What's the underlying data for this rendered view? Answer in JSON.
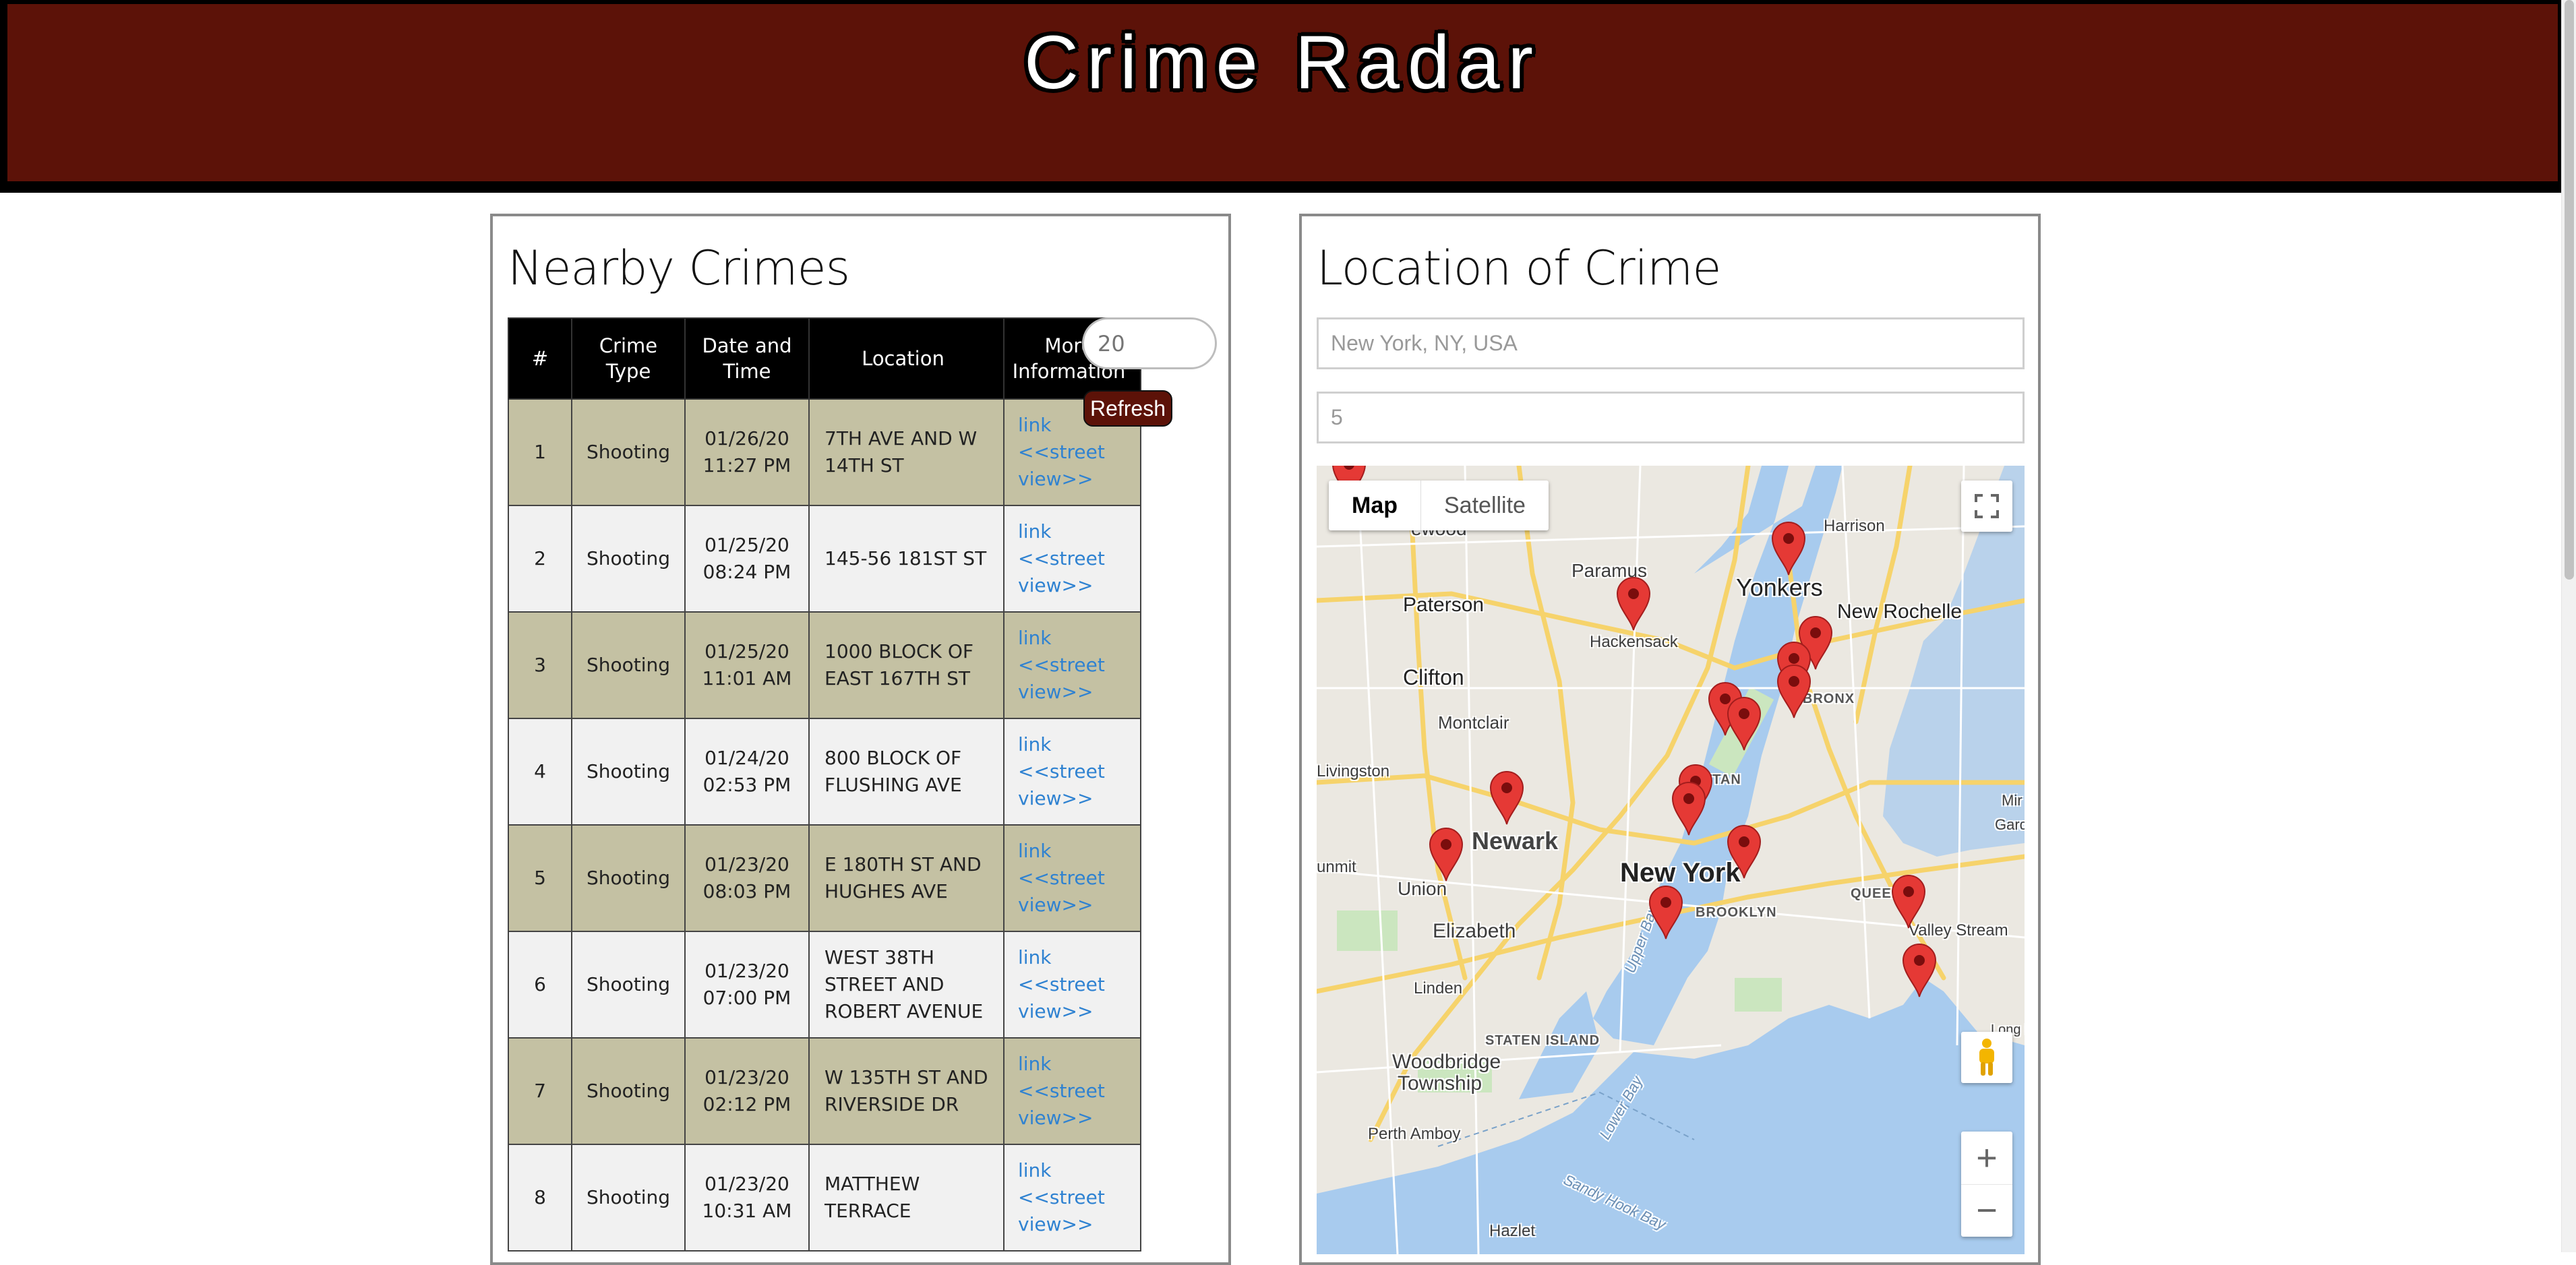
{
  "header": {
    "title": "Crime Radar"
  },
  "left_panel": {
    "title": "Nearby Crimes",
    "count_input": {
      "placeholder": "20"
    },
    "refresh_label": "Refresh",
    "columns": [
      "#",
      "Crime Type",
      "Date and Time",
      "Location",
      "More Information"
    ],
    "rows": [
      {
        "num": "1",
        "type": "Shooting",
        "date": "01/26/20",
        "time": "11:27 PM",
        "loc1": "7TH AVE AND W",
        "loc2": "14TH ST",
        "loc3": "",
        "link": "link",
        "street1": "<<street",
        "street2": "view>>"
      },
      {
        "num": "2",
        "type": "Shooting",
        "date": "01/25/20",
        "time": "08:24 PM",
        "loc1": "145-56 181ST ST",
        "loc2": "",
        "loc3": "",
        "link": "link",
        "street1": "<<street",
        "street2": "view>>"
      },
      {
        "num": "3",
        "type": "Shooting",
        "date": "01/25/20",
        "time": "11:01 AM",
        "loc1": "1000 BLOCK OF",
        "loc2": "EAST 167TH ST",
        "loc3": "",
        "link": "link",
        "street1": "<<street",
        "street2": "view>>"
      },
      {
        "num": "4",
        "type": "Shooting",
        "date": "01/24/20",
        "time": "02:53 PM",
        "loc1": "800 BLOCK OF",
        "loc2": "FLUSHING AVE",
        "loc3": "",
        "link": "link",
        "street1": "<<street",
        "street2": "view>>"
      },
      {
        "num": "5",
        "type": "Shooting",
        "date": "01/23/20",
        "time": "08:03 PM",
        "loc1": "E 180TH ST AND",
        "loc2": "HUGHES AVE",
        "loc3": "",
        "link": "link",
        "street1": "<<street",
        "street2": "view>>"
      },
      {
        "num": "6",
        "type": "Shooting",
        "date": "01/23/20",
        "time": "07:00 PM",
        "loc1": "WEST 38TH",
        "loc2": "STREET AND",
        "loc3": "ROBERT AVENUE",
        "link": "link",
        "street1": "<<street",
        "street2": "view>>"
      },
      {
        "num": "7",
        "type": "Shooting",
        "date": "01/23/20",
        "time": "02:12 PM",
        "loc1": "W 135TH ST AND",
        "loc2": "RIVERSIDE DR",
        "loc3": "",
        "link": "link",
        "street1": "<<street",
        "street2": "view>>"
      },
      {
        "num": "8",
        "type": "Shooting",
        "date": "01/23/20",
        "time": "10:31 AM",
        "loc1": "MATTHEW",
        "loc2": "TERRACE",
        "loc3": "",
        "link": "link",
        "street1": "<<street",
        "street2": "view>>"
      }
    ]
  },
  "right_panel": {
    "title": "Location of Crime",
    "location_input": {
      "placeholder": "New York, NY, USA"
    },
    "radius_input": {
      "placeholder": "5"
    },
    "map": {
      "map_type_buttons": [
        "Map",
        "Satellite"
      ],
      "zoom_in": "+",
      "zoom_out": "−",
      "labels": {
        "yonkers": "Yonkers",
        "new_rochelle": "New Rochelle",
        "paterson": "Paterson",
        "paramus": "Paramus",
        "hackensack": "Hackensack",
        "clifton": "Clifton",
        "montclair": "Montclair",
        "the_bronx": "E BRONX",
        "livingston": "Livingston",
        "newark": "Newark",
        "union": "Union",
        "new_york": "New York",
        "manhattan": "ATTAN",
        "brooklyn": "BROOKLYN",
        "queens": "QUEENS",
        "elizabeth": "Elizabeth",
        "linden": "Linden",
        "staten_island": "STATEN ISLAND",
        "woodbridge": "Woodbridge",
        "township": "Township",
        "perth_amboy": "Perth Amboy",
        "valley_stream": "Valley Stream",
        "upper_bay": "Upper Bay",
        "lower_bay": "Lower Bay",
        "sandy_hook": "Sandy Hook Bay",
        "hazlet": "Hazlet",
        "harrison": "Harrison",
        "ewood": "ewood",
        "mit": "unmit",
        "garc": "Garc",
        "mir": "Mir",
        "long_b": "Long B"
      },
      "icons": {
        "fullscreen": "fullscreen-icon",
        "pegman": "pegman-icon",
        "pin": "map-pin-icon"
      },
      "pin_color": "#e53935"
    }
  },
  "colors": {
    "banner": "#5c1208",
    "odd_row": "#c4c1a3",
    "even_row": "#f1f1f1",
    "link": "#2f82d1",
    "refresh_button": "#5c1208"
  }
}
